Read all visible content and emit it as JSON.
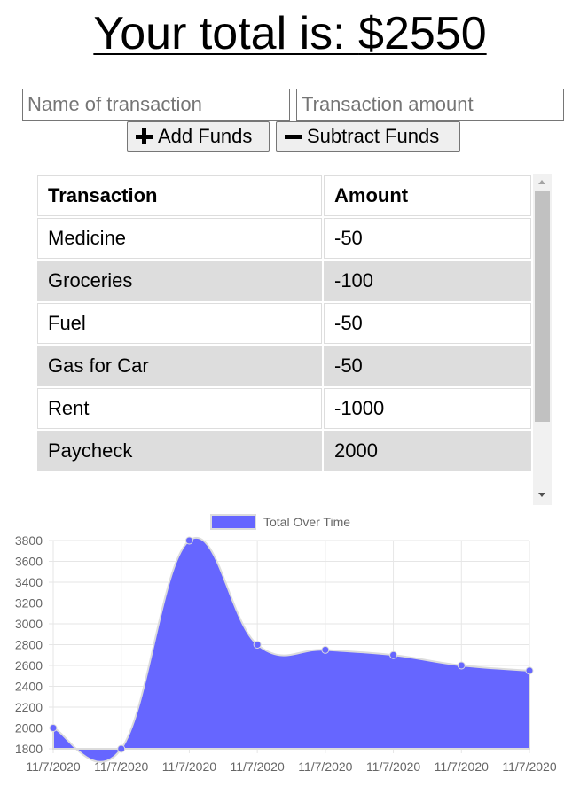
{
  "header": {
    "prefix": "Your total is: ",
    "total": "$2550"
  },
  "form": {
    "name_placeholder": "Name of transaction",
    "amount_placeholder": "Transaction amount",
    "add_label": "Add Funds",
    "subtract_label": "Subtract Funds",
    "add_icon": "plus-icon",
    "subtract_icon": "minus-icon"
  },
  "table": {
    "headers": [
      "Transaction",
      "Amount"
    ],
    "rows": [
      {
        "name": "Medicine",
        "amount": "-50"
      },
      {
        "name": "Groceries",
        "amount": "-100"
      },
      {
        "name": "Fuel",
        "amount": "-50"
      },
      {
        "name": "Gas for Car",
        "amount": "-50"
      },
      {
        "name": "Rent",
        "amount": "-1000"
      },
      {
        "name": "Paycheck",
        "amount": "2000"
      }
    ]
  },
  "chart_data": {
    "type": "area",
    "legend": [
      "Total Over Time"
    ],
    "legend_position": "top",
    "x": [
      "11/7/2020",
      "11/7/2020",
      "11/7/2020",
      "11/7/2020",
      "11/7/2020",
      "11/7/2020",
      "11/7/2020",
      "11/7/2020"
    ],
    "series": [
      {
        "name": "Total Over Time",
        "values": [
          2000,
          1800,
          3800,
          2800,
          2750,
          2700,
          2600,
          2550
        ]
      }
    ],
    "ylim": [
      1800,
      3800
    ],
    "yticks": [
      1800,
      2000,
      2200,
      2400,
      2600,
      2800,
      3000,
      3200,
      3400,
      3600,
      3800
    ],
    "grid": true,
    "fill_color": "#6666ff",
    "line_color": "#dcdcdc"
  }
}
